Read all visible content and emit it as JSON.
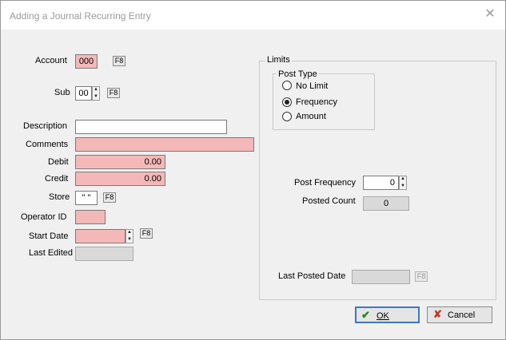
{
  "window": {
    "title": "Adding a Journal Recurring Entry",
    "close_glyph": "✕"
  },
  "left": {
    "account": {
      "label": "Account",
      "value": "000",
      "f8": "F8"
    },
    "sub": {
      "label": "Sub",
      "value": "00",
      "f8": "F8"
    },
    "description": {
      "label": "Description",
      "value": ""
    },
    "comments": {
      "label": "Comments",
      "value": ""
    },
    "debit": {
      "label": "Debit",
      "value": "0.00"
    },
    "credit": {
      "label": "Credit",
      "value": "0.00"
    },
    "store": {
      "label": "Store",
      "value": "\" \"",
      "f8": "F8"
    },
    "operator_id": {
      "label": "Operator ID",
      "value": ""
    },
    "start_date": {
      "label": "Start Date",
      "value": "",
      "f8": "F8"
    },
    "last_edited": {
      "label": "Last Edited",
      "value": ""
    }
  },
  "limits": {
    "title": "Limits",
    "post_type": {
      "title": "Post Type",
      "options": [
        "No Limit",
        "Frequency",
        "Amount"
      ],
      "selected": "Frequency"
    },
    "post_frequency": {
      "label": "Post Frequency",
      "value": "0"
    },
    "posted_count": {
      "label": "Posted Count",
      "value": "0"
    },
    "last_posted_date": {
      "label": "Last Posted Date",
      "value": "",
      "f8": "F8"
    }
  },
  "buttons": {
    "ok": {
      "label": "OK",
      "icon": "check-icon"
    },
    "cancel": {
      "label": "Cancel",
      "icon": "x-icon"
    }
  },
  "colors": {
    "required_field": "#f4b8b8",
    "default_button_border": "#3b77c9",
    "title_text": "#9b9b9b"
  }
}
